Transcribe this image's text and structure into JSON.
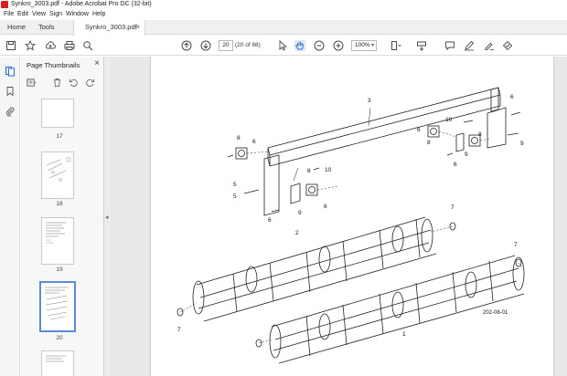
{
  "window": {
    "title": "Synkro_3003.pdf - Adobe Acrobat Pro DC (32-bit)"
  },
  "menu": {
    "items": [
      "File",
      "Edit",
      "View",
      "Sign",
      "Window",
      "Help"
    ]
  },
  "tabs": {
    "home": "Home",
    "tools": "Tools",
    "document": "Synkro_3003.pdf",
    "close_glyph": "×"
  },
  "toolbar": {
    "page_input": "20",
    "page_count": "(20 of 88)",
    "zoom": "100%"
  },
  "thumbnails_panel": {
    "title": "Page Thumbnails",
    "close_glyph": "×",
    "pages": [
      {
        "label": "17"
      },
      {
        "label": "18"
      },
      {
        "label": "19"
      },
      {
        "label": "20",
        "selected": true
      },
      {
        "label": ""
      }
    ]
  },
  "document": {
    "callouts": [
      "3",
      "6",
      "10",
      "6",
      "8",
      "9",
      "6",
      "8",
      "9",
      "8",
      "6",
      "10",
      "8",
      "5",
      "9",
      "6",
      "5",
      "6",
      "7",
      "2",
      "7",
      "7",
      "1"
    ],
    "figure_code": "202-08-01"
  }
}
